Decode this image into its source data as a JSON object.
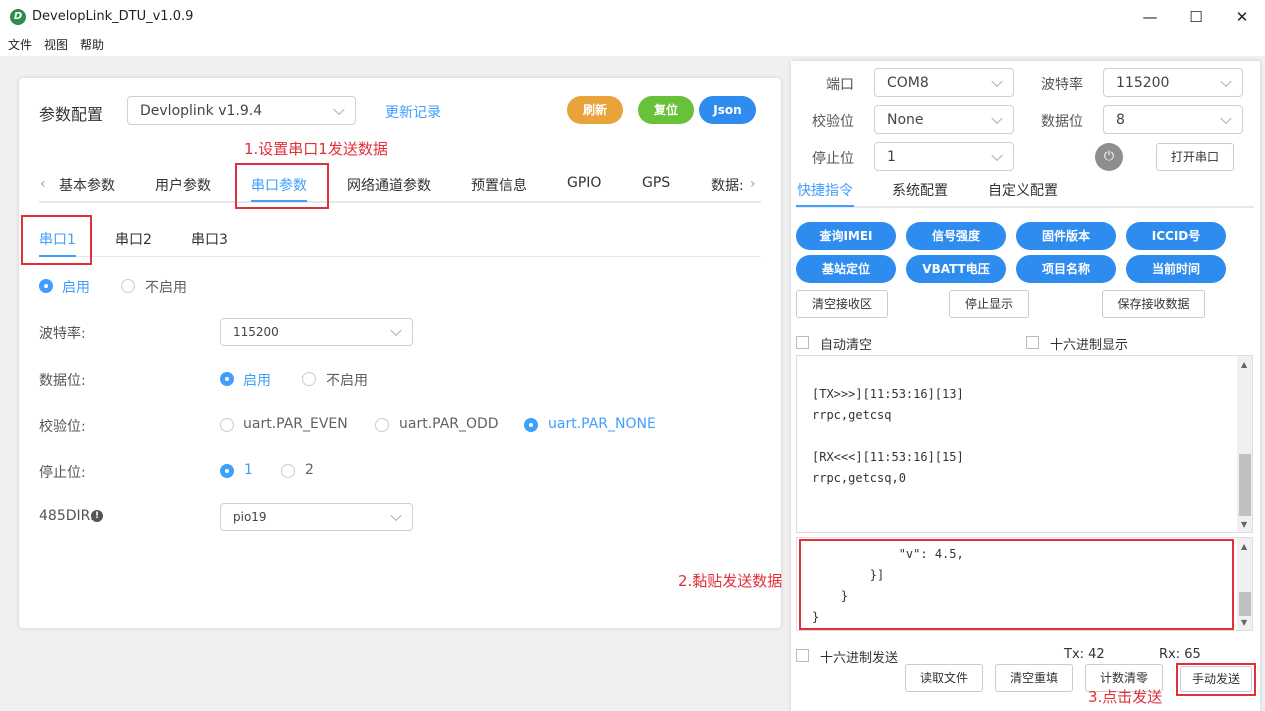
{
  "app": {
    "logo": "D",
    "title": "DevelopLink_DTU_v1.0.9",
    "minimize": "—",
    "maximize": "☐",
    "close": "✕"
  },
  "menu": [
    "文件",
    "视图",
    "帮助"
  ],
  "left": {
    "title": "参数配置",
    "version": "Devloplink v1.9.4",
    "changelog": "更新记录",
    "btn_refresh": "刷新",
    "btn_reset": "复位",
    "btn_json": "Json",
    "tabs": [
      "基本参数",
      "用户参数",
      "串口参数",
      "网络通道参数",
      "预置信息",
      "GPIO",
      "GPS",
      "数据:"
    ],
    "subtabs": [
      "串口1",
      "串口2",
      "串口3"
    ],
    "enable": "启用",
    "disable": "不启用",
    "baud_label": "波特率:",
    "baud_value": "115200",
    "databit_label": "数据位:",
    "databit_on": "启用",
    "databit_off": "不启用",
    "parity_label": "校验位:",
    "parity_even": "uart.PAR_EVEN",
    "parity_odd": "uart.PAR_ODD",
    "parity_none": "uart.PAR_NONE",
    "stop_label": "停止位:",
    "stop_1": "1",
    "stop_2": "2",
    "dir_label": "485DIR:",
    "dir_value": "pio19"
  },
  "right": {
    "port_label": "端口",
    "port_value": "COM8",
    "baud_label": "波特率",
    "baud_value": "115200",
    "parity_label": "校验位",
    "parity_value": "None",
    "databit_label": "数据位",
    "databit_value": "8",
    "stop_label": "停止位",
    "stop_value": "1",
    "open_port": "打开串口",
    "tabs": [
      "快捷指令",
      "系统配置",
      "自定义配置"
    ],
    "cmds": [
      "查询IMEI",
      "信号强度",
      "固件版本",
      "ICCID号",
      "基站定位",
      "VBATT电压",
      "项目名称",
      "当前时间"
    ],
    "clear_recv": "清空接收区",
    "stop_show": "停止显示",
    "save_recv": "保存接收数据",
    "auto_clear": "自动清空",
    "hex_show": "十六进制显示",
    "log": [
      "[TX>>>][11:53:16][13]",
      "rrpc,getcsq",
      "",
      "[RX<<<][11:53:16][15]",
      "rrpc,getcsq,0"
    ],
    "send": [
      "            \"v\": 4.5,",
      "        }]",
      "    }",
      "}"
    ],
    "hex_send": "十六进制发送",
    "tx": "Tx: 42",
    "rx": "Rx: 65",
    "read_file": "读取文件",
    "clear_refill": "清空重填",
    "count_clear": "计数清零",
    "manual_send": "手动发送"
  },
  "annotations": {
    "a1": "1.设置串口1发送数据",
    "a2": "2.黏贴发送数据",
    "a3": "3.点击发送"
  },
  "colors": {
    "accent": "#409eff",
    "refresh": "#e8a33b",
    "reset": "#67c23a",
    "json": "#2e8cef",
    "annotation": "#e0303a"
  }
}
